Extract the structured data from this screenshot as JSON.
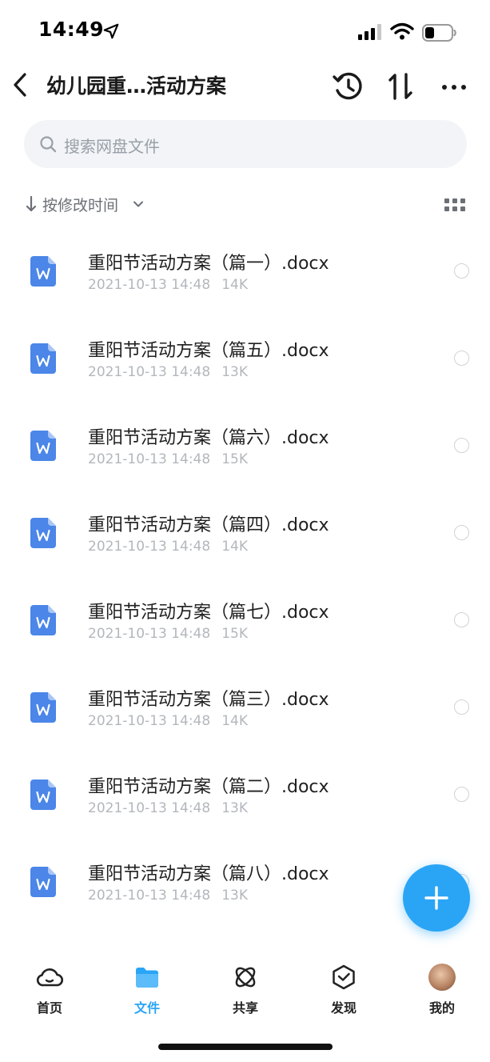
{
  "status_bar": {
    "time": "14:49"
  },
  "header": {
    "title": "幼儿园重…活动方案"
  },
  "search": {
    "placeholder": "搜索网盘文件"
  },
  "sort": {
    "label": "按修改时间"
  },
  "files": [
    {
      "name": "重阳节活动方案（篇一）.docx",
      "date": "2021-10-13 14:48",
      "size": "14K"
    },
    {
      "name": "重阳节活动方案（篇五）.docx",
      "date": "2021-10-13 14:48",
      "size": "13K"
    },
    {
      "name": "重阳节活动方案（篇六）.docx",
      "date": "2021-10-13 14:48",
      "size": "15K"
    },
    {
      "name": "重阳节活动方案（篇四）.docx",
      "date": "2021-10-13 14:48",
      "size": "14K"
    },
    {
      "name": "重阳节活动方案（篇七）.docx",
      "date": "2021-10-13 14:48",
      "size": "15K"
    },
    {
      "name": "重阳节活动方案（篇三）.docx",
      "date": "2021-10-13 14:48",
      "size": "14K"
    },
    {
      "name": "重阳节活动方案（篇二）.docx",
      "date": "2021-10-13 14:48",
      "size": "13K"
    },
    {
      "name": "重阳节活动方案（篇八）.docx",
      "date": "2021-10-13 14:48",
      "size": "13K"
    }
  ],
  "nav": {
    "home": "首页",
    "files": "文件",
    "share": "共享",
    "discover": "发现",
    "me": "我的"
  },
  "colors": {
    "accent": "#2aa5f6",
    "word_icon": "#4b86e8"
  }
}
